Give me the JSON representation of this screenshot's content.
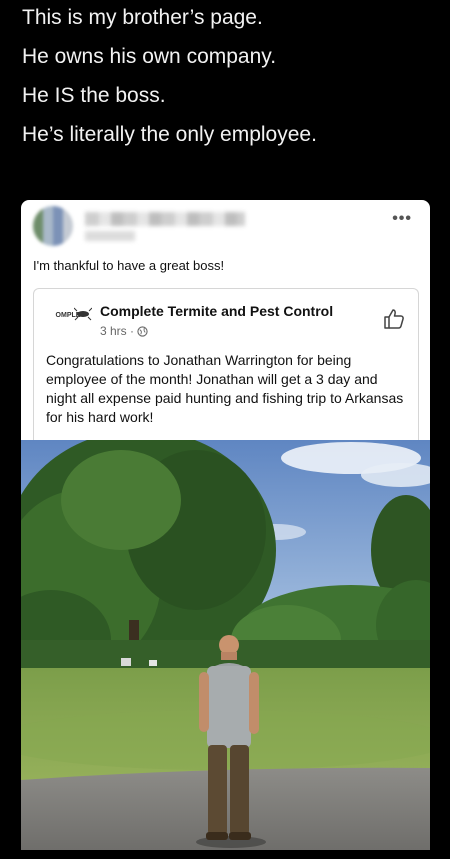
{
  "caption": {
    "lines": [
      "This is my brother’s page.",
      "He owns his own company.",
      "He IS the boss.",
      "He’s literally the only employee."
    ]
  },
  "post": {
    "text": "I'm thankful to have a great boss!",
    "more_icon": "more-horizontal-icon"
  },
  "shared": {
    "logo_text": "OMPLE",
    "page_name": "Complete Termite and Pest Control",
    "time": "3 hrs ·",
    "body": "Congratulations to Jonathan Warrington for being employee of the month! Jonathan will get a 3 day and night all expense paid hunting and fishing trip to Arkansas for his hard work!"
  },
  "colors": {
    "background": "#000000",
    "card": "#ffffff",
    "text": "#111111",
    "muted": "#666666"
  }
}
